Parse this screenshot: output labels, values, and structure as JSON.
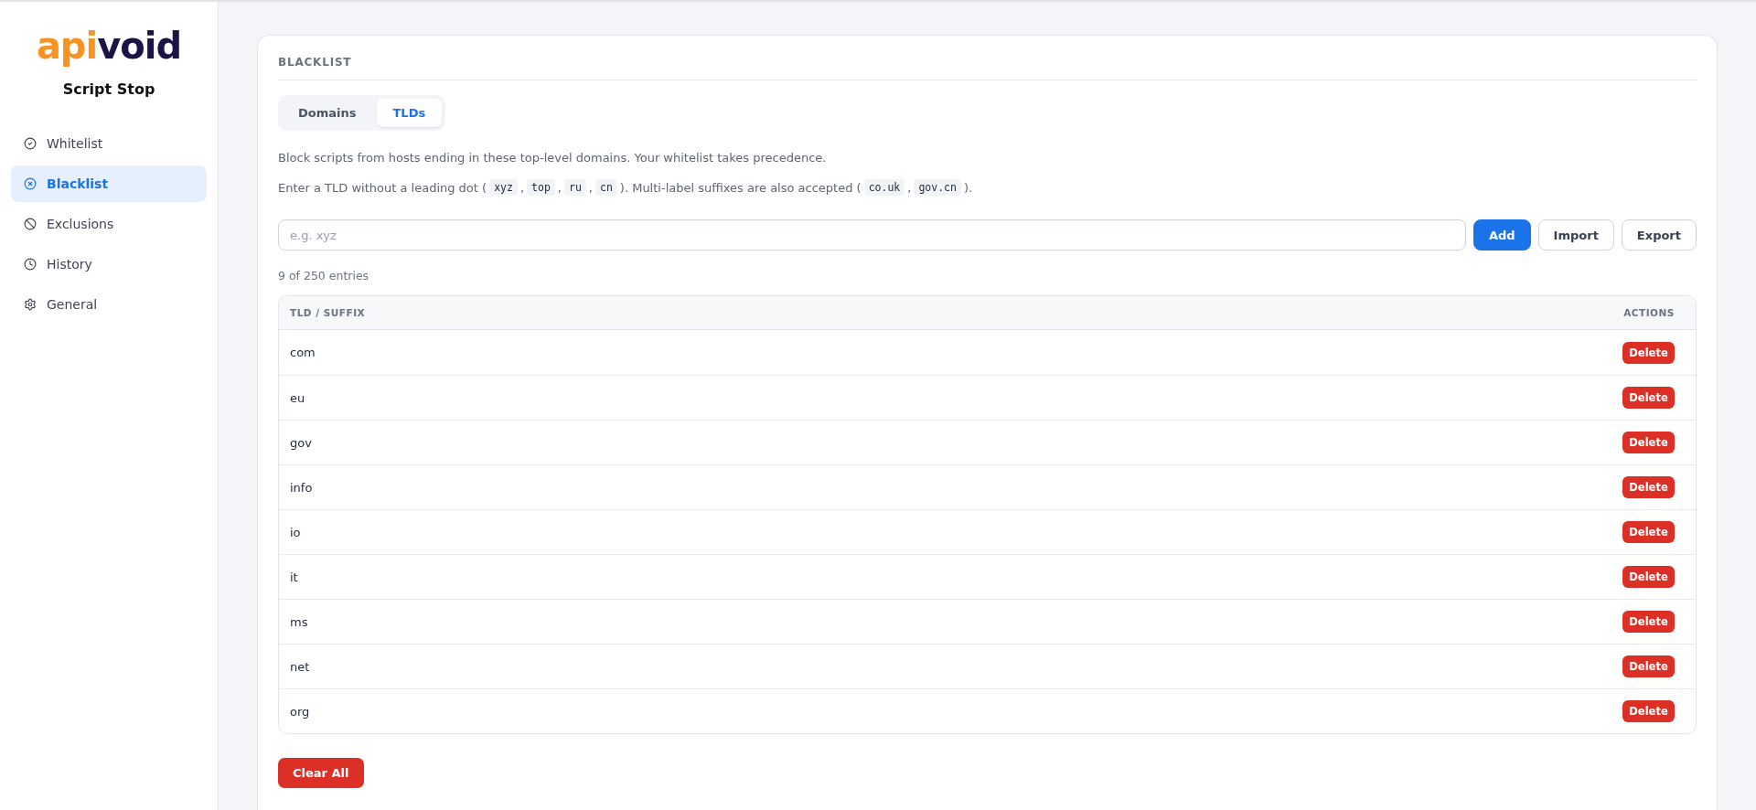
{
  "sidebar": {
    "logo": [
      {
        "text": "api",
        "kind": "accent"
      },
      {
        "text": "void",
        "kind": "base"
      }
    ],
    "app_name": "Script Stop",
    "items": [
      {
        "label": "Whitelist",
        "kind": "check",
        "selected": false
      },
      {
        "label": "Blacklist",
        "kind": "x",
        "selected": true
      },
      {
        "label": "Exclusions",
        "kind": "ban",
        "selected": false
      },
      {
        "label": "History",
        "kind": "clock",
        "selected": false
      },
      {
        "label": "General",
        "kind": "gear",
        "selected": false
      }
    ]
  },
  "panel": {
    "title": "BLACKLIST",
    "tabs": [
      {
        "label": "Domains",
        "selected": false
      },
      {
        "label": "TLDs",
        "selected": true
      }
    ],
    "description": "Block scripts from hosts ending in these top-level domains. Your whitelist takes precedence.",
    "hint": [
      {
        "kind": "text",
        "text": "Enter a TLD without a leading dot ("
      },
      {
        "kind": "code",
        "text": "xyz"
      },
      {
        "kind": "text",
        "text": ","
      },
      {
        "kind": "code",
        "text": "top"
      },
      {
        "kind": "text",
        "text": ","
      },
      {
        "kind": "code",
        "text": "ru"
      },
      {
        "kind": "text",
        "text": ","
      },
      {
        "kind": "code",
        "text": "cn"
      },
      {
        "kind": "text",
        "text": "). Multi-label suffixes are also accepted ("
      },
      {
        "kind": "code",
        "text": "co.uk"
      },
      {
        "kind": "text",
        "text": ","
      },
      {
        "kind": "code",
        "text": "gov.cn"
      },
      {
        "kind": "text",
        "text": ")."
      }
    ],
    "input": {
      "placeholder": "e.g. xyz"
    },
    "buttons": [
      {
        "label": "Add",
        "kind": "primary"
      },
      {
        "label": "Import",
        "kind": "outline"
      },
      {
        "label": "Export",
        "kind": "outline"
      }
    ],
    "count": "9 of 250 entries",
    "table": {
      "columns": [
        "TLD / SUFFIX",
        "ACTIONS"
      ],
      "rows": [
        {
          "tld": "com",
          "action": "Delete"
        },
        {
          "tld": "eu",
          "action": "Delete"
        },
        {
          "tld": "gov",
          "action": "Delete"
        },
        {
          "tld": "info",
          "action": "Delete"
        },
        {
          "tld": "io",
          "action": "Delete"
        },
        {
          "tld": "it",
          "action": "Delete"
        },
        {
          "tld": "ms",
          "action": "Delete"
        },
        {
          "tld": "net",
          "action": "Delete"
        },
        {
          "tld": "org",
          "action": "Delete"
        }
      ]
    },
    "clear_button": "Clear All"
  }
}
